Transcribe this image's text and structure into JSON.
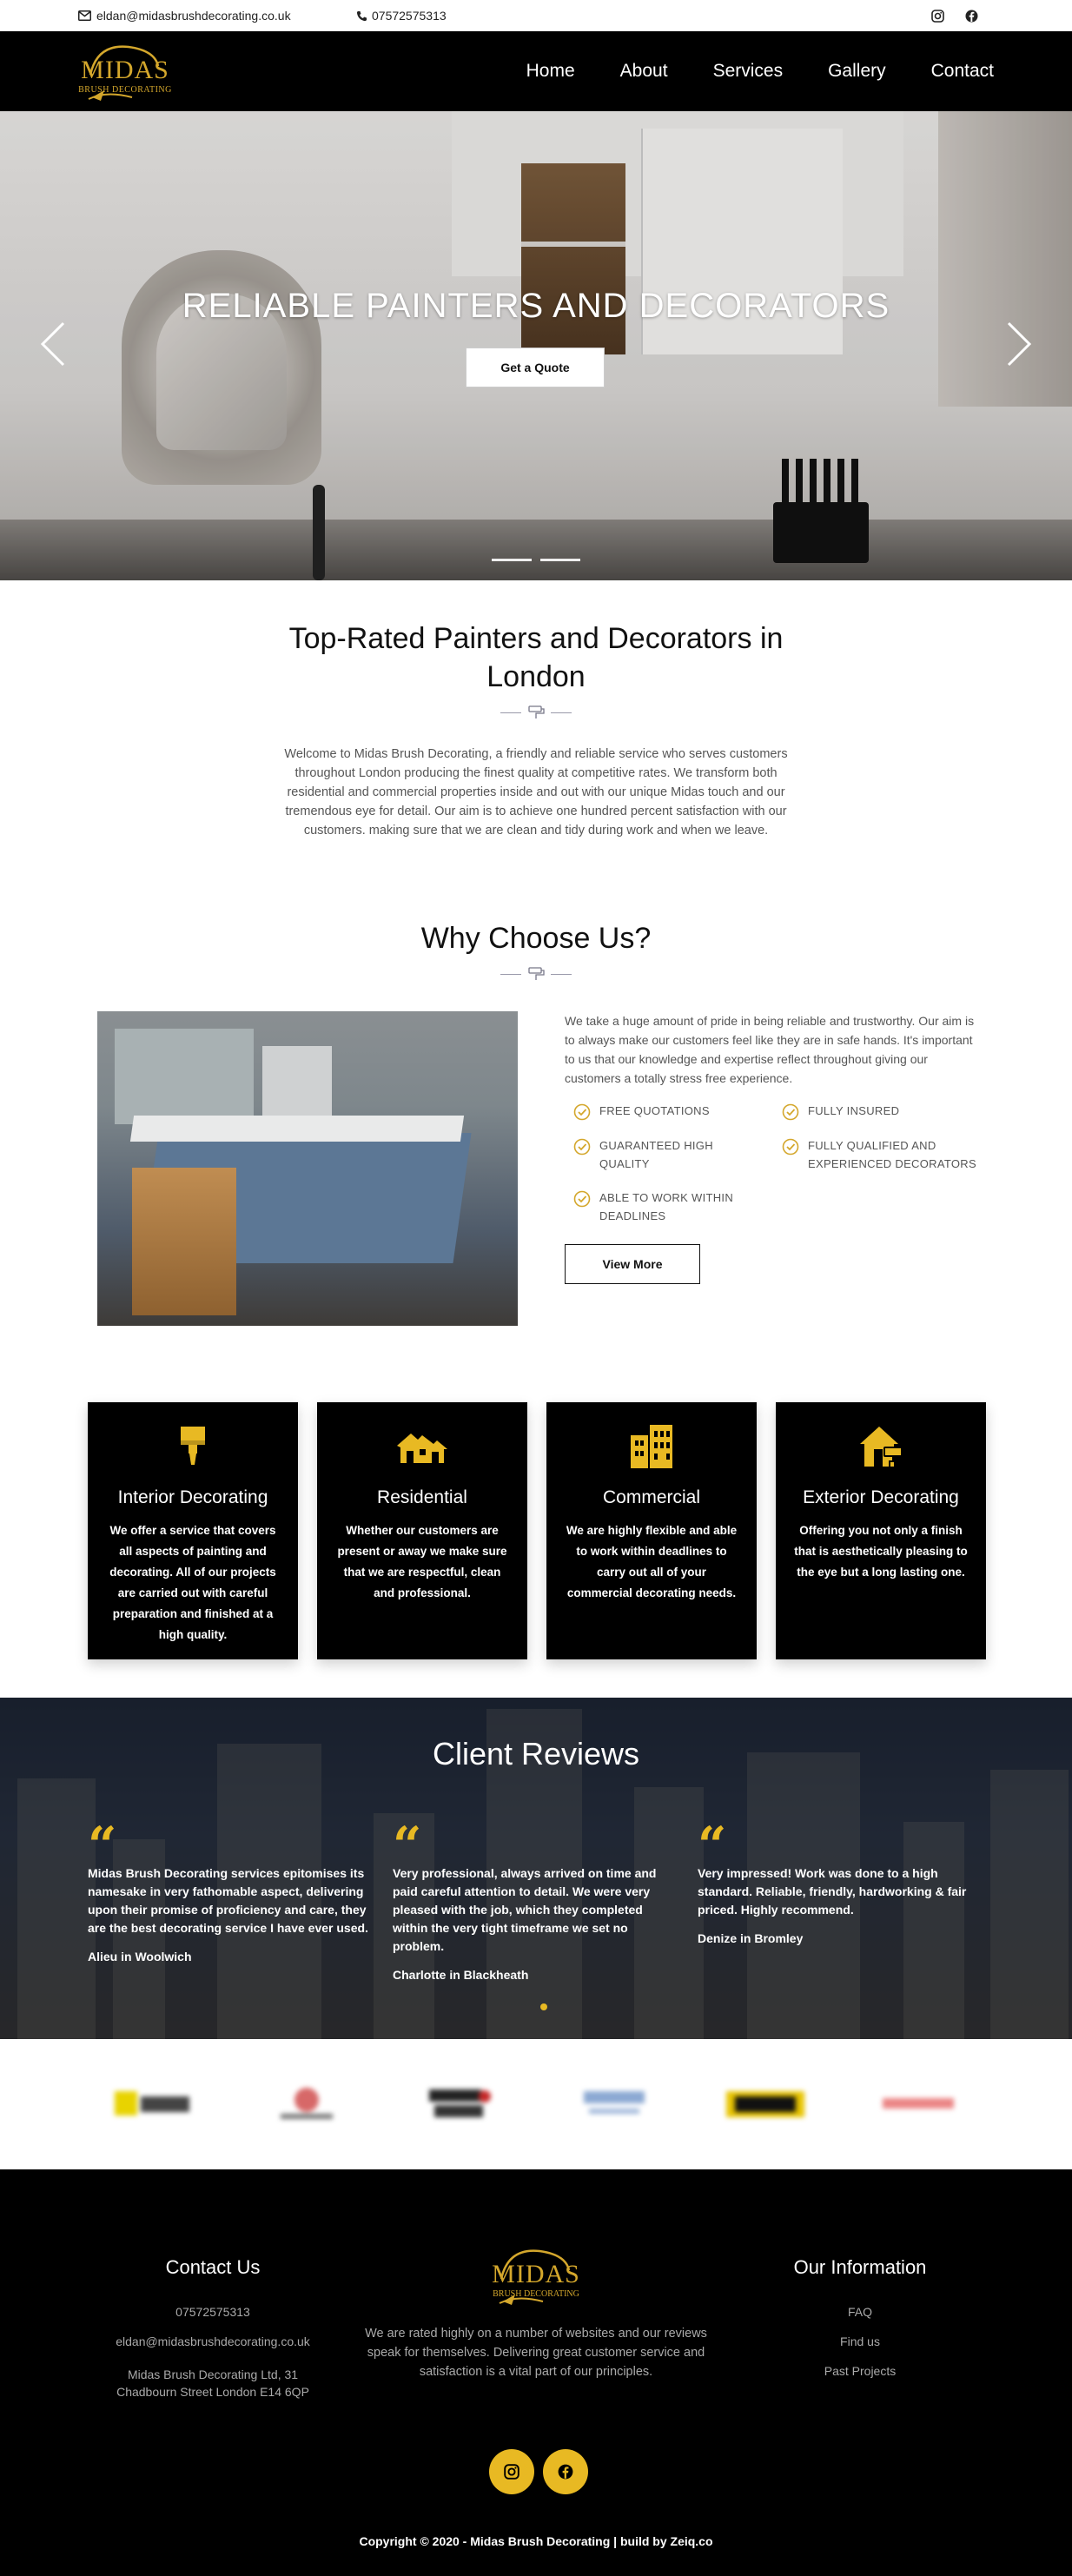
{
  "topbar": {
    "email": "eldan@midasbrushdecorating.co.uk",
    "phone": "07572575313",
    "icons": [
      "envelope-icon",
      "phone-icon",
      "instagram-icon",
      "facebook-icon"
    ]
  },
  "brand": {
    "name": "MIDAS",
    "tagline": "BRUSH DECORATING",
    "accent": "#e8b923"
  },
  "nav": {
    "items": [
      "Home",
      "About",
      "Services",
      "Gallery",
      "Contact"
    ]
  },
  "hero": {
    "title": "RELIABLE PAINTERS AND DECORATORS",
    "button": "Get a Quote",
    "prev_icon": "chevron-left-icon",
    "next_icon": "chevron-right-icon"
  },
  "intro": {
    "title": "Top-Rated Painters and Decorators in London",
    "body": "Welcome to Midas Brush Decorating, a friendly and reliable service who serves customers throughout London producing the finest quality at competitive rates. We transform both residential and commercial properties inside and out with our unique Midas touch and our tremendous eye for detail. Our aim is to achieve one hundred percent satisfaction with our customers. making sure that we are clean and tidy during work and when we leave."
  },
  "why": {
    "title": "Why Choose Us?",
    "body": "We take a huge amount of pride in being reliable and trustworthy. Our aim is to always make our customers feel like they are in safe hands. It's important to us that our knowledge and expertise reflect throughout giving our customers a totally stress free experience.",
    "checks": [
      "FREE QUOTATIONS",
      "FULLY INSURED",
      "GUARANTEED HIGH QUALITY",
      "FULLY QUALIFIED AND EXPERIENCED DECORATORS",
      "ABLE TO WORK WITHIN DEADLINES"
    ],
    "button": "View More"
  },
  "services": [
    {
      "title": "Interior Decorating",
      "icon": "paint-brush-icon",
      "text": "We offer a service that covers all aspects of painting and decorating. All of our projects are carried out with careful preparation and finished at a high quality."
    },
    {
      "title": "Residential",
      "icon": "houses-icon",
      "text": "Whether our customers are present or away we make sure that we are respectful, clean and professional."
    },
    {
      "title": "Commercial",
      "icon": "building-icon",
      "text": "We are highly flexible and able to work within deadlines to carry out all of your commercial decorating needs."
    },
    {
      "title": "Exterior Decorating",
      "icon": "house-paint-roller-icon",
      "text": "Offering you not only a finish that is aesthetically pleasing to the eye but a long lasting one."
    }
  ],
  "reviews": {
    "title": "Client Reviews",
    "items": [
      {
        "text": "Midas Brush Decorating services epitomises its namesake in very fathomable aspect, delivering upon their promise of proficiency and care, they are the best decorating service I have ever used.",
        "author": "Alieu in Woolwich"
      },
      {
        "text": "Very professional, always arrived on time and paid careful attention to detail. We were very pleased with the job, which they completed within the very tight timeframe we set no problem.",
        "author": "Charlotte in Blackheath"
      },
      {
        "text": "Very impressed! Work was done to a high standard. Reliable, friendly, hardworking & fair priced. Highly recommend.",
        "author": "Denize in Bromley"
      }
    ]
  },
  "footer": {
    "contact_title": "Contact Us",
    "phone": "07572575313",
    "email": "eldan@midasbrushdecorating.co.uk",
    "address": "Midas Brush Decorating Ltd, 31 Chadbourn Street London E14 6QP",
    "about": "We are rated highly on a number of websites and our reviews speak for themselves. Delivering great customer service and satisfaction is a vital part of our principles.",
    "info_title": "Our Information",
    "links": [
      "FAQ",
      "Find us",
      "Past Projects"
    ],
    "copyright": "Copyright © 2020 - Midas Brush Decorating | build by Zeiq.co"
  }
}
